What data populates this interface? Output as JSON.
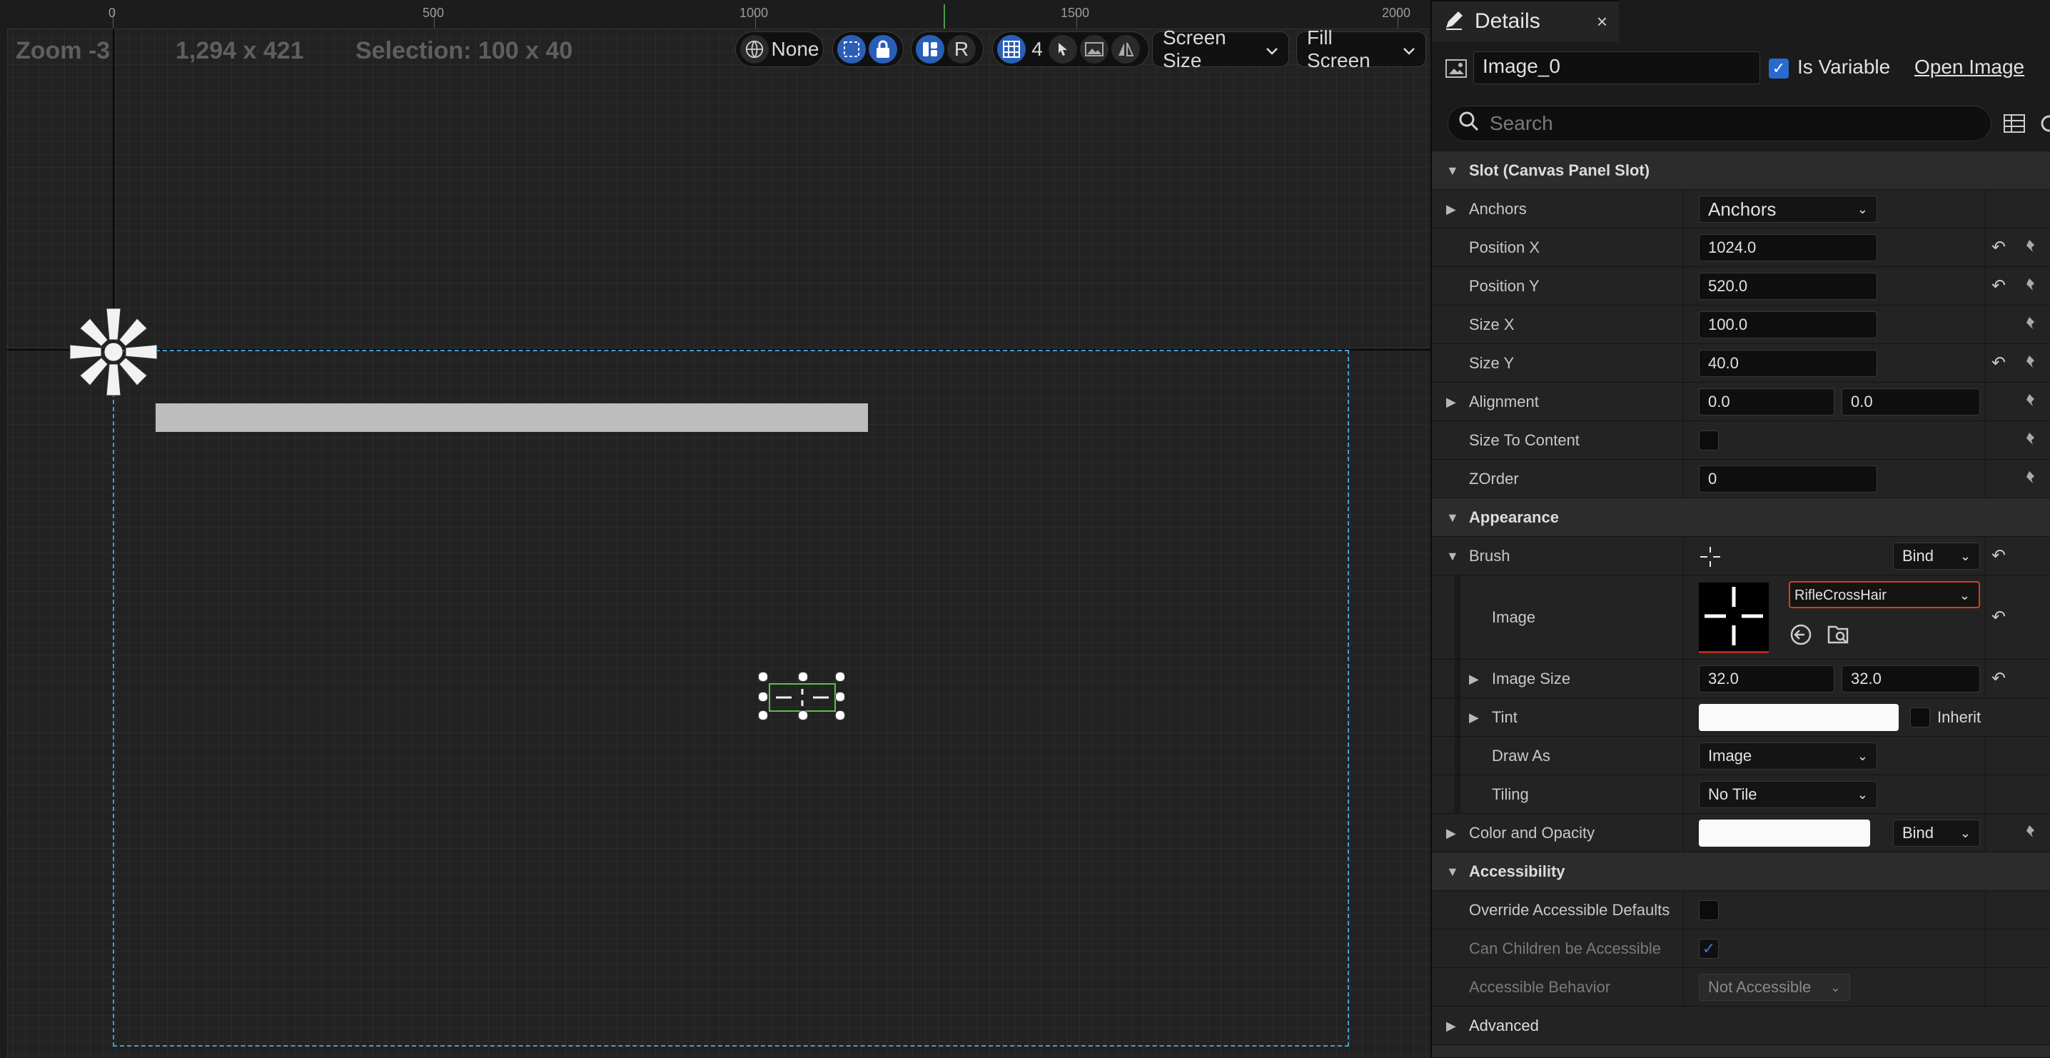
{
  "viewport": {
    "zoom": "Zoom -3",
    "resolution": "1,294 x 421",
    "selection": "Selection: 100 x 40",
    "ruler_ticks": [
      "0",
      "500",
      "1000",
      "1500",
      "2000"
    ],
    "toolbar": {
      "localization_label": "None",
      "r_label": "R",
      "grid_value": "4",
      "screen_size_label": "Screen Size",
      "fill_screen_label": "Fill Screen"
    }
  },
  "details": {
    "tab_title": "Details",
    "close_glyph": "×",
    "widget_name": "Image_0",
    "is_variable_label": "Is Variable",
    "is_variable_checked": true,
    "open_image_label": "Open Image",
    "search_placeholder": "Search",
    "sections": {
      "slot": "Slot (Canvas Panel Slot)",
      "appearance": "Appearance",
      "accessibility": "Accessibility",
      "advanced": "Advanced"
    },
    "props": {
      "anchors_label": "Anchors",
      "anchors_value": "Anchors",
      "position_x_label": "Position X",
      "position_x": "1024.0",
      "position_y_label": "Position Y",
      "position_y": "520.0",
      "size_x_label": "Size X",
      "size_x": "100.0",
      "size_y_label": "Size Y",
      "size_y": "40.0",
      "alignment_label": "Alignment",
      "alignment_x": "0.0",
      "alignment_y": "0.0",
      "size_to_content_label": "Size To Content",
      "zorder_label": "ZOrder",
      "zorder": "0",
      "brush_label": "Brush",
      "bind_label": "Bind",
      "image_label": "Image",
      "image_asset": "RifleCrossHair",
      "image_size_label": "Image Size",
      "image_size_x": "32.0",
      "image_size_y": "32.0",
      "tint_label": "Tint",
      "inherit_label": "Inherit",
      "draw_as_label": "Draw As",
      "draw_as": "Image",
      "tiling_label": "Tiling",
      "tiling": "No Tile",
      "color_opacity_label": "Color and Opacity",
      "override_accessible_label": "Override Accessible Defaults",
      "can_children_label": "Can Children be Accessible",
      "accessible_behavior_label": "Accessible Behavior",
      "accessible_behavior": "Not Accessible"
    }
  },
  "colors": {
    "accent_blue": "#2a6ad0",
    "selection_green": "#5ac24a",
    "canvas_border": "#3aa0d8",
    "highlight_red": "#d0421c"
  }
}
